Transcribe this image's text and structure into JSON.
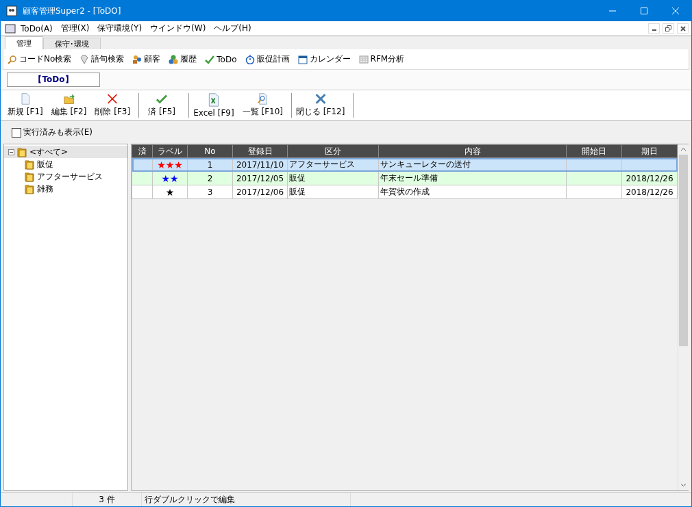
{
  "window": {
    "title": "顧客管理Super2 - [ToDO]"
  },
  "menu": [
    "ToDo(A)",
    "管理(X)",
    "保守環境(Y)",
    "ウインドウ(W)",
    "ヘルプ(H)"
  ],
  "tabs": [
    {
      "label": "管理",
      "selected": true
    },
    {
      "label": "保守･環境",
      "selected": false
    }
  ],
  "nav_toolbar": [
    {
      "kind": "search",
      "label": "コードNo検索"
    },
    {
      "kind": "gem",
      "label": "語句検索"
    },
    {
      "kind": "people",
      "label": "顧客"
    },
    {
      "kind": "coins",
      "label": "履歴"
    },
    {
      "kind": "check",
      "label": "ToDo"
    },
    {
      "kind": "stopwatch",
      "label": "販促計画"
    },
    {
      "kind": "calendar",
      "label": "カレンダー"
    },
    {
      "kind": "grid",
      "label": "RFM分析"
    }
  ],
  "view_title": "【ToDo】",
  "actions": [
    [
      {
        "kind": "new",
        "label": "新規 [F1]"
      },
      {
        "kind": "edit",
        "label": "編集 [F2]"
      },
      {
        "kind": "delete",
        "label": "削除 [F3]"
      }
    ],
    [
      {
        "kind": "done",
        "label": "済 [F5]"
      }
    ],
    [
      {
        "kind": "excel",
        "label": "Excel [F9]"
      },
      {
        "kind": "list",
        "label": "一覧 [F10]"
      }
    ],
    [
      {
        "kind": "close",
        "label": "閉じる [F12]"
      }
    ]
  ],
  "show_done": {
    "label": "実行済みも表示(E)",
    "checked": false
  },
  "tree": [
    {
      "label": "<すべて>",
      "expanded": true,
      "selected": true,
      "children": [
        {
          "label": "販促",
          "selected": false
        },
        {
          "label": "アフターサービス",
          "selected": false
        },
        {
          "label": "雑務",
          "selected": false
        }
      ]
    }
  ],
  "table": {
    "columns": [
      "済",
      "ラベル",
      "No",
      "登録日",
      "区分",
      "内容",
      "開始日",
      "期日"
    ],
    "rows": [
      {
        "selected": true,
        "label": "★★★",
        "color": "#ff0000",
        "no": "1",
        "registered": "2017/11/10",
        "category": "アフターサービス",
        "content": "サンキューレターの送付",
        "due": ""
      },
      {
        "selected": false,
        "label": "★★",
        "color": "#0000ff",
        "no": "2",
        "registered": "2017/12/05",
        "category": "販促",
        "content": "年末セール準備",
        "due": "2018/12/26"
      },
      {
        "selected": false,
        "label": "★",
        "color": "#000000",
        "no": "3",
        "registered": "2017/12/06",
        "category": "販促",
        "content": "年賀状の作成",
        "due": "2018/12/26"
      }
    ]
  },
  "status_bar": {
    "count": "3 件",
    "hint": "行ダブルクリックで編集"
  }
}
